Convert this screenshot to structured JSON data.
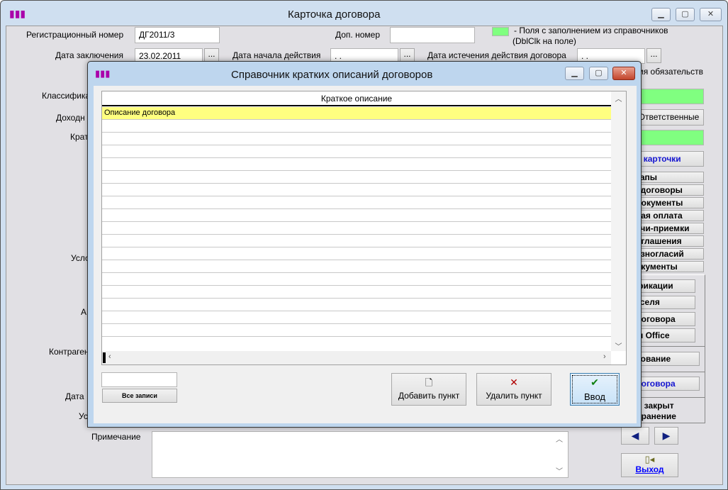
{
  "main": {
    "title": "Карточка договора",
    "reg_label": "Регистрационный номер",
    "reg_value": "ДГ2011/3",
    "extra_label": "Доп. номер",
    "extra_value": "",
    "legend_text": "-  Поля с заполнением из справочников",
    "legend_hint": "(DblClk на поле)",
    "date_label": "Дата заключения",
    "date_value": "23.02.2011",
    "start_label": "Дата начала действия",
    "start_value": " . .",
    "end_label": "Дата истечения действия договора",
    "end_value": " . .",
    "obligations_label": "ия обязательств",
    "ellipsis": "...",
    "left_labels": [
      "Классифика",
      "Доходн",
      "Крат",
      "Усло",
      "А",
      "Контраген",
      "Дата ,",
      "Ус"
    ],
    "note_label": "Примечание",
    "note_value": "",
    "right_buttons": {
      "responsible": "Ответственные",
      "card": "ь карточки",
      "stages": "тапы",
      "contracts": ". договоры",
      "documents": " документы",
      "payment": "ная оплата",
      "acts": "ачи-приемки",
      "agreements": "оглашения",
      "disagreements": "азногласий",
      "docs2": "окументы"
    },
    "group_buttons": [
      "фикации",
      "кселя",
      "договора",
      "ы Office"
    ],
    "approval": "сование",
    "contract_link": "договора",
    "closed_line1": "о закрыт",
    "closed_line2": "хранение",
    "exit": "Выход"
  },
  "dialog": {
    "title": "Справочник кратких описаний договоров",
    "column_header": "Краткое описание",
    "rows": [
      "Описание договора",
      "",
      "",
      "",
      "",
      "",
      "",
      "",
      "",
      "",
      "",
      "",
      "",
      "",
      "",
      "",
      "",
      ""
    ],
    "search_value": "",
    "all_records": "Все записи",
    "add": "Добавить пункт",
    "delete": "Удалить пункт",
    "enter": "Ввод"
  },
  "colors": {
    "highlight": "#ffff80",
    "lookup_field": "#80ff80"
  }
}
